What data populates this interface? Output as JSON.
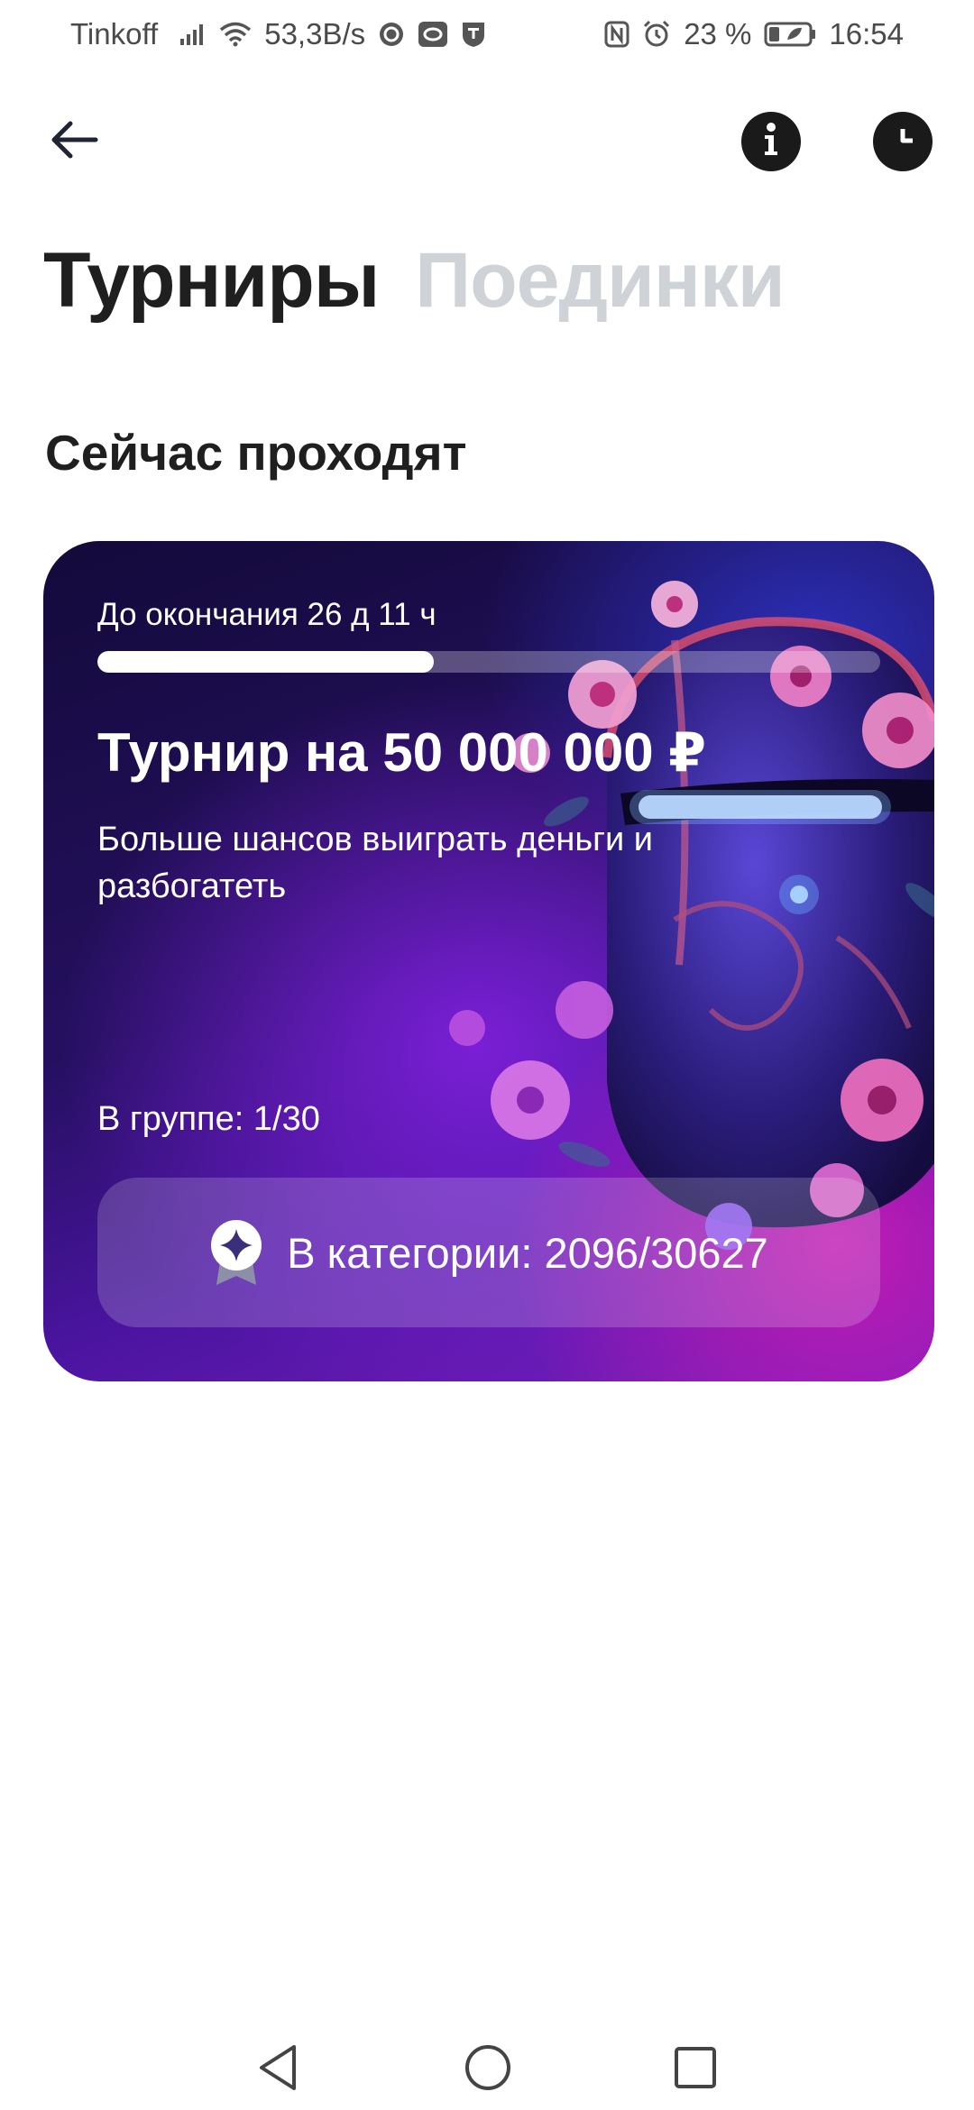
{
  "status_bar": {
    "carrier": "Tinkoff",
    "speed": "53,3B/s",
    "battery": "23 %",
    "time": "16:54"
  },
  "nav": {
    "back_icon": "arrow-left-icon",
    "info_icon": "info-icon",
    "history_icon": "clock-icon"
  },
  "tabs": [
    {
      "label": "Турниры",
      "active": true
    },
    {
      "label": "Поединки",
      "active": false
    }
  ],
  "section_title": "Сейчас проходят",
  "tournament": {
    "deadline": "До окончания 26 д 11 ч",
    "progress": 0.43,
    "title": "Турнир на 50 000 000 ₽",
    "subtitle": "Больше шансов выиграть деньги и разбогатеть",
    "group_rank": "В группе: 1/30",
    "category_rank": "В категории: 2096/30627",
    "category_icon": "medal-icon"
  },
  "colors": {
    "accent_dark": "#1a1a1a",
    "tab_inactive": "#cfd2d6",
    "card_purple": "#7a1fd6",
    "card_magenta": "#c21bb4"
  }
}
